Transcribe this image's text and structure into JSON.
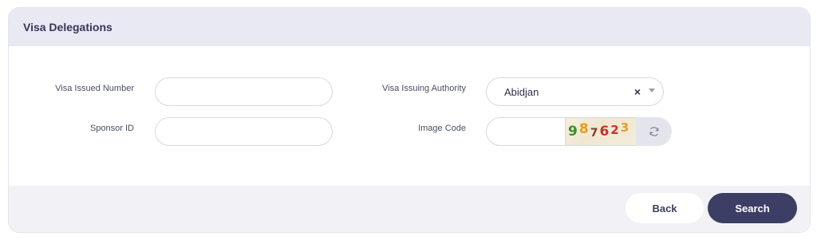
{
  "panel": {
    "title": "Visa Delegations"
  },
  "form": {
    "visa_issued_number": {
      "label": "Visa Issued Number",
      "value": ""
    },
    "sponsor_id": {
      "label": "Sponsor ID",
      "value": ""
    },
    "visa_issuing_authority": {
      "label": "Visa Issuing Authority",
      "value": "Abidjan",
      "clear": "×"
    },
    "image_code": {
      "label": "Image Code",
      "value": "",
      "captcha_digits": [
        {
          "char": "9",
          "color": "#3a8f2a"
        },
        {
          "char": "8",
          "color": "#e3a01c"
        },
        {
          "char": "7",
          "color": "#8a3b2c"
        },
        {
          "char": "6",
          "color": "#c9302c"
        },
        {
          "char": "2",
          "color": "#c9302c"
        },
        {
          "char": "3",
          "color": "#e3a01c"
        }
      ],
      "refresh_icon": "refresh-icon"
    }
  },
  "actions": {
    "back": "Back",
    "search": "Search"
  }
}
